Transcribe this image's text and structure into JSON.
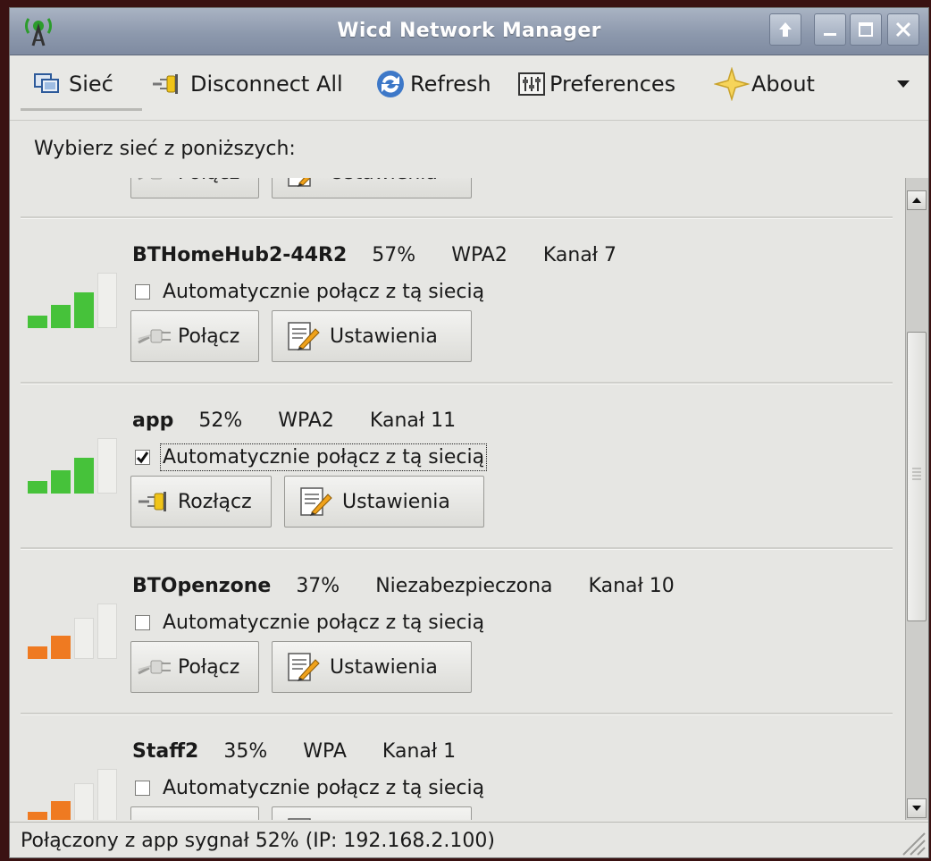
{
  "window": {
    "title": "Wicd Network Manager"
  },
  "toolbar": {
    "siec_label": "Sieć",
    "disconnect_all_label": "Disconnect All",
    "refresh_label": "Refresh",
    "preferences_label": "Preferences",
    "about_label": "About"
  },
  "content": {
    "header": "Wybierz sieć z poniższych:"
  },
  "networks": [
    {
      "name": "",
      "strength": "",
      "encryption": "",
      "channel": "",
      "auto_label": "",
      "auto_checked": false,
      "connect_label": "Połącz",
      "settings_label": "Ustawienia",
      "signal_bars": 0,
      "signal_color": "#46c23a"
    },
    {
      "name": "BTHomeHub2-44R2",
      "strength": "57%",
      "encryption": "WPA2",
      "channel": "Kanał 7",
      "auto_label": "Automatycznie połącz z tą siecią",
      "auto_checked": false,
      "connect_label": "Połącz",
      "settings_label": "Ustawienia",
      "signal_bars": 3,
      "signal_color": "#46c23a"
    },
    {
      "name": "app",
      "strength": "52%",
      "encryption": "WPA2",
      "channel": "Kanał 11",
      "auto_label": "Automatycznie połącz z tą siecią",
      "auto_checked": true,
      "connect_label": "Rozłącz",
      "settings_label": "Ustawienia",
      "signal_bars": 3,
      "signal_color": "#46c23a"
    },
    {
      "name": "BTOpenzone",
      "strength": "37%",
      "encryption": "Niezabezpieczona",
      "channel": "Kanał 10",
      "auto_label": "Automatycznie połącz z tą siecią",
      "auto_checked": false,
      "connect_label": "Połącz",
      "settings_label": "Ustawienia",
      "signal_bars": 2,
      "signal_color": "#ef7a21"
    },
    {
      "name": "Staff2",
      "strength": "35%",
      "encryption": "WPA",
      "channel": "Kanał 1",
      "auto_label": "Automatycznie połącz z tą siecią",
      "auto_checked": false,
      "connect_label": "",
      "settings_label": "",
      "signal_bars": 2,
      "signal_color": "#ef7a21"
    }
  ],
  "statusbar": {
    "text": "Połączony z app sygnał 52% (IP: 192.168.2.100)"
  }
}
